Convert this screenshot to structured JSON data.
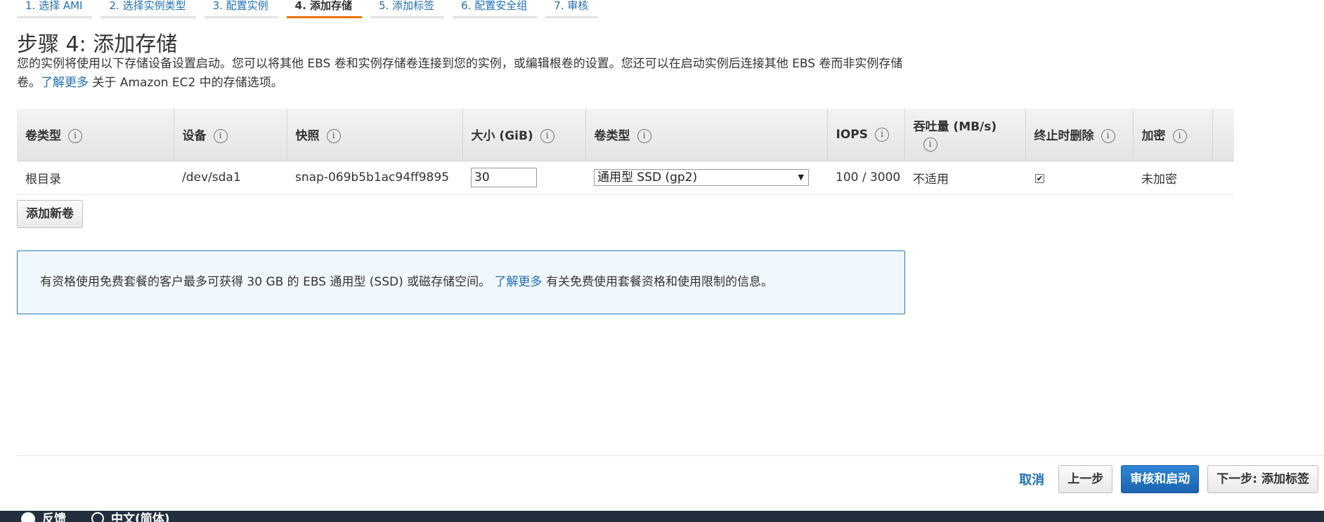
{
  "steps": [
    {
      "label": "1. 选择 AMI"
    },
    {
      "label": "2. 选择实例类型"
    },
    {
      "label": "3. 配置实例"
    },
    {
      "label": "4. 添加存储"
    },
    {
      "label": "5. 添加标签"
    },
    {
      "label": "6. 配置安全组"
    },
    {
      "label": "7. 审核"
    }
  ],
  "active_step": 3,
  "page": {
    "title": "步骤 4: 添加存储",
    "description": "您的实例将使用以下存储设备设置启动。您可以将其他 EBS 卷和实例存储卷连接到您的实例，或编辑根卷的设置。您还可以在启动实例后连接其他 EBS 卷而非实例存储卷。",
    "learn_more": "了解更多",
    "description_suffix": "关于 Amazon EC2 中的存储选项。"
  },
  "table": {
    "headers": {
      "volume_type": "卷类型",
      "device": "设备",
      "snapshot": "快照",
      "size": "大小 (GiB)",
      "ebs_type": "卷类型",
      "iops": "IOPS",
      "throughput": "吞吐量 (MB/s)",
      "delete_on_termination": "终止时删除",
      "encryption": "加密"
    },
    "info_glyph": "i",
    "row": {
      "volume_type": "根目录",
      "device": "/dev/sda1",
      "snapshot": "snap-069b5b1ac94ff9895",
      "size": "30",
      "ebs_type": "通用型 SSD (gp2)",
      "iops": "100 / 3000",
      "throughput": "不适用",
      "delete_on_termination": true,
      "delete_on_termination_glyph": "✔",
      "encryption": "未加密"
    }
  },
  "add_volume_label": "添加新卷",
  "info_box": {
    "text": "有资格使用免费套餐的客户最多可获得 30 GB 的 EBS 通用型 (SSD) 或磁存储空间。",
    "link": "了解更多",
    "suffix": "有关免费使用套餐资格和使用限制的信息。"
  },
  "actions": {
    "cancel": "取消",
    "previous": "上一步",
    "review_launch": "审核和启动",
    "next": "下一步: 添加标签"
  },
  "bottom_bar": {
    "feedback": "反馈",
    "language": "中文(简体)"
  },
  "colors": {
    "link": "#1f6fb8",
    "active_tab_accent": "#ec7211",
    "primary_button": "#1b64b0",
    "info_box_border": "#2a7ac0",
    "bottom_bar": "#232f3e"
  },
  "icons": {
    "info": "info-icon",
    "select_caret": "chevron-down-icon",
    "checkbox": "checkbox-checked-icon",
    "feedback": "feedback-icon",
    "language": "globe-icon"
  }
}
